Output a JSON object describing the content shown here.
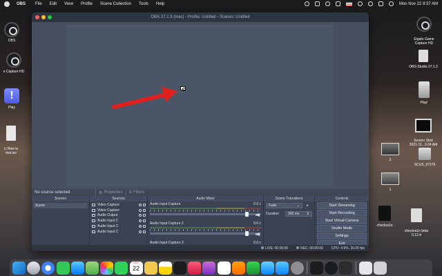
{
  "menubar": {
    "app": "OBS",
    "items": [
      "File",
      "Edit",
      "View",
      "Profile",
      "Scene Collection",
      "Tools",
      "Help"
    ],
    "clock": "Mon Nov 22  9:37 AM"
  },
  "desktop_left": [
    {
      "label": "OBS"
    },
    {
      "label": "e Capture HD"
    },
    {
      "label": "Play"
    },
    {
      "label": "Li Rise to\nmor.iso"
    }
  ],
  "desktop_right": [
    {
      "label": "Elgato Game\nCapture HD"
    },
    {
      "label": "OBS-Studio 27.1.3"
    },
    {
      "label": "Play!"
    },
    {
      "label": "Screen Shot\n2021-11...3.04 AM"
    },
    {
      "label": "2"
    },
    {
      "label": "SCUS_97279"
    },
    {
      "label": "1"
    },
    {
      "label": "checkra1n"
    },
    {
      "label": "checkra1n beta\n0.12.4"
    }
  ],
  "window": {
    "title": "OBS 27.1.3 (mac) - Profile: Untitled - Scenes: Untitled",
    "no_source": "No source selected",
    "properties_label": "Properties",
    "filters_label": "Filters"
  },
  "docks": {
    "scenes": {
      "title": "Scenes",
      "items": [
        "Scene"
      ]
    },
    "sources": {
      "title": "Sources",
      "items": [
        {
          "name": "Video Capture",
          "icon": "monitor-icon"
        },
        {
          "name": "Video Capture",
          "icon": "monitor-icon"
        },
        {
          "name": "Audio Output",
          "icon": "speaker-icon"
        },
        {
          "name": "Audio Input C",
          "icon": "mic-icon"
        },
        {
          "name": "Audio Input C",
          "icon": "mic-icon"
        },
        {
          "name": "Audio Input C",
          "icon": "mic-icon"
        }
      ]
    },
    "mixer": {
      "title": "Audio Mixer",
      "channels": [
        {
          "name": "Audio Input Capture",
          "db": "0.0 c"
        },
        {
          "name": "Audio Input Capture 2",
          "db": "0.0 c"
        },
        {
          "name": "Audio Input Capture 3",
          "db": "0.0 c"
        }
      ]
    },
    "transitions": {
      "title": "Scene Transitions",
      "transition": "Fade",
      "duration_label": "Duration",
      "duration": "300 ms"
    },
    "controls": {
      "title": "Controls",
      "buttons": [
        "Start Streaming",
        "Start Recording",
        "Start Virtual Camera",
        "Studio Mode",
        "Settings",
        "Exit"
      ]
    }
  },
  "status": {
    "live": "LIVE: 00:00:00",
    "rec": "REC: 00:00:00",
    "cpu": "CPU: 4.9%, 30.00 fps"
  },
  "dock_calendar": {
    "month": "NOV",
    "day": "22"
  },
  "colors": {
    "accent_red": "#e0201c",
    "obs_bg": "#3b4252"
  }
}
